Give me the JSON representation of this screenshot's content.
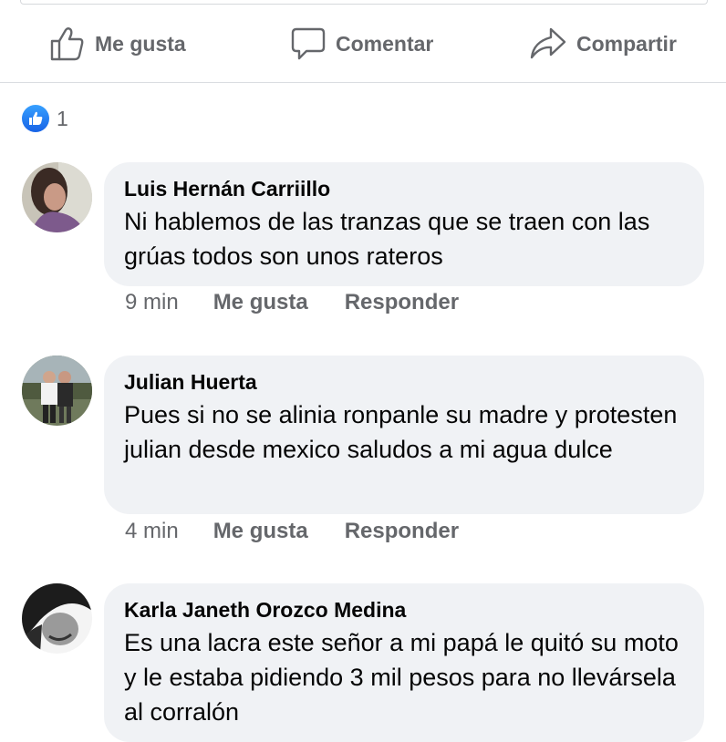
{
  "action_bar": {
    "like_label": "Me gusta",
    "comment_label": "Comentar",
    "share_label": "Compartir"
  },
  "reactions": {
    "count": "1",
    "icon": "like-icon"
  },
  "comments": [
    {
      "author": "Luis Hernán Carriillo",
      "text": "Ni hablemos de las tranzas que se traen con las grúas todos son unos rateros",
      "time": "9 min",
      "like_label": "Me gusta",
      "reply_label": "Responder"
    },
    {
      "author": "Julian Huerta",
      "text": "Pues si no se alinia ronpanle su madre y protesten julian desde mexico saludos a mi agua dulce",
      "time": "4 min",
      "like_label": "Me gusta",
      "reply_label": "Responder"
    },
    {
      "author": "Karla Janeth Orozco Medina",
      "text": "Es una lacra este señor a mi papá le quitó su moto y le estaba pidiendo 3 mil pesos para no llevársela al corralón"
    }
  ],
  "colors": {
    "accent": "#1877f2",
    "secondary_text": "#65676b",
    "bubble": "#f0f2f5"
  }
}
